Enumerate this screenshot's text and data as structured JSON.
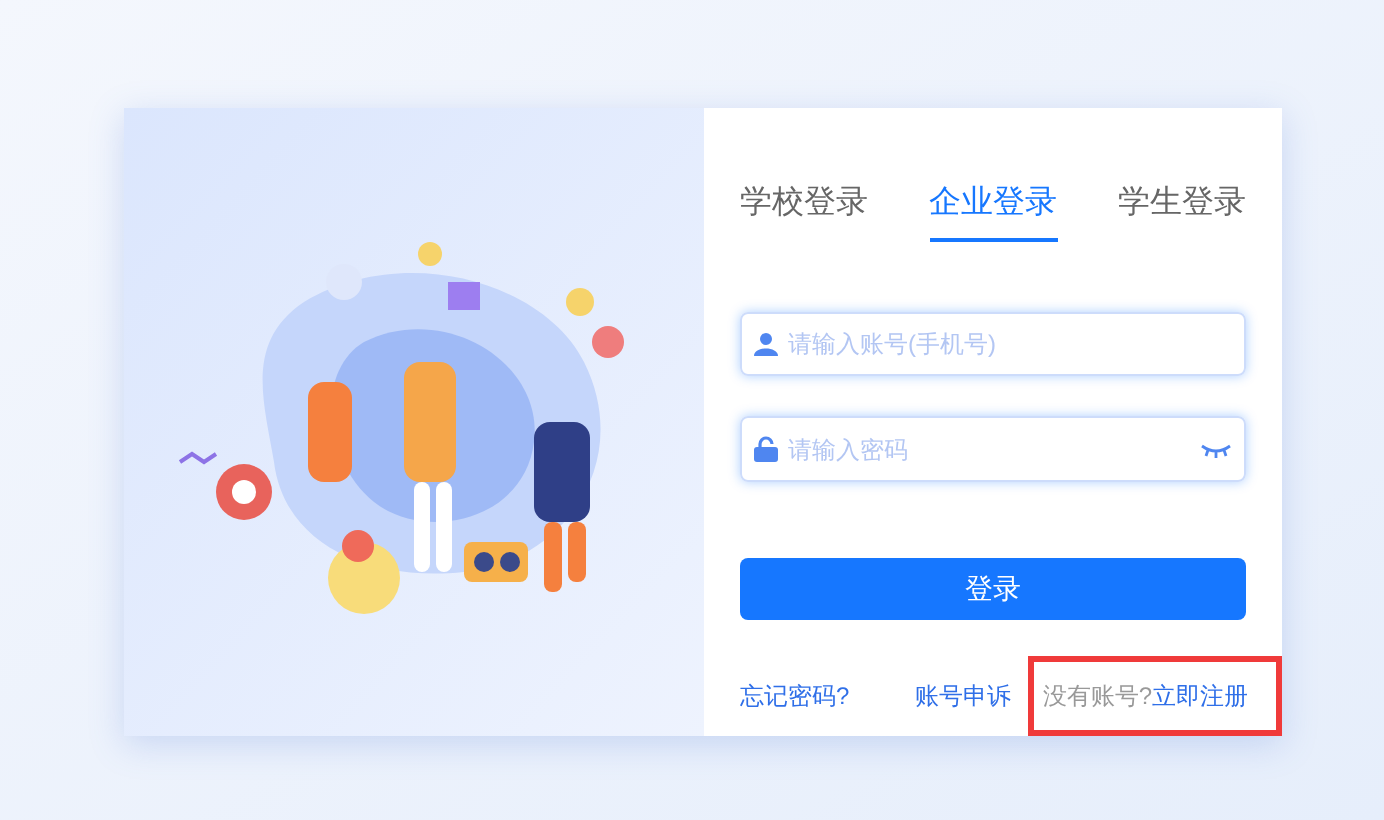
{
  "tabs": [
    {
      "label": "学校登录",
      "selected": false
    },
    {
      "label": "企业登录",
      "selected": true
    },
    {
      "label": "学生登录",
      "selected": false
    }
  ],
  "account_field": {
    "placeholder": "请输入账号(手机号)"
  },
  "password_field": {
    "placeholder": "请输入密码"
  },
  "login_button": "登录",
  "links": [
    {
      "label": "忘记密码?"
    },
    {
      "label": "账号申诉"
    }
  ],
  "register": {
    "prompt": "没有账号?",
    "link": "立即注册",
    "highlighted": true
  }
}
